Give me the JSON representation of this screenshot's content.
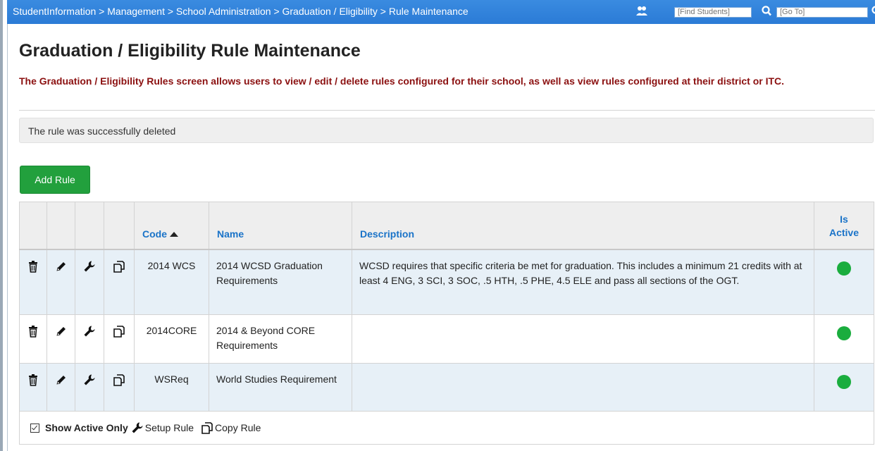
{
  "topbar": {
    "breadcrumb": "StudentInformation > Management > School Administration > Graduation / Eligibility > Rule Maintenance",
    "find_students_placeholder": "[Find Students]",
    "goto_placeholder": "[Go To]"
  },
  "page": {
    "title": "Graduation / Eligibility Rule Maintenance",
    "description": "The Graduation / Eligibility Rules screen allows users to view / edit / delete rules configured for their school, as well as view rules configured at their district or ITC.",
    "alert": "The rule was successfully deleted",
    "add_button": "Add Rule"
  },
  "table": {
    "headers": {
      "code": "Code",
      "name": "Name",
      "description": "Description",
      "is_active_line1": "Is",
      "is_active_line2": "Active"
    },
    "rows": [
      {
        "code": "2014 WCS",
        "name": "2014 WCSD Graduation Requirements",
        "description": "WCSD requires that specific criteria be met for graduation. This includes a minimum 21 credits with at least 4 ENG, 3 SCI, 3 SOC, .5 HTH, .5 PHE, 4.5 ELE and pass all sections of the OGT.",
        "active": true
      },
      {
        "code": "2014CORE",
        "name": "2014 & Beyond CORE Requirements",
        "description": "",
        "active": true
      },
      {
        "code": "WSReq",
        "name": "World Studies Requirement",
        "description": "",
        "active": true
      }
    ]
  },
  "footer": {
    "show_active_only": "Show Active Only",
    "setup_rule": "Setup Rule",
    "copy_rule": "Copy Rule",
    "show_active_checked": true
  },
  "colors": {
    "topbar": "#2b7bd6",
    "add_button": "#22a03d",
    "active_dot": "#1aad3e",
    "description_text": "#8b1010",
    "header_link": "#1a73c8",
    "row_alt": "#e7f0f7"
  }
}
